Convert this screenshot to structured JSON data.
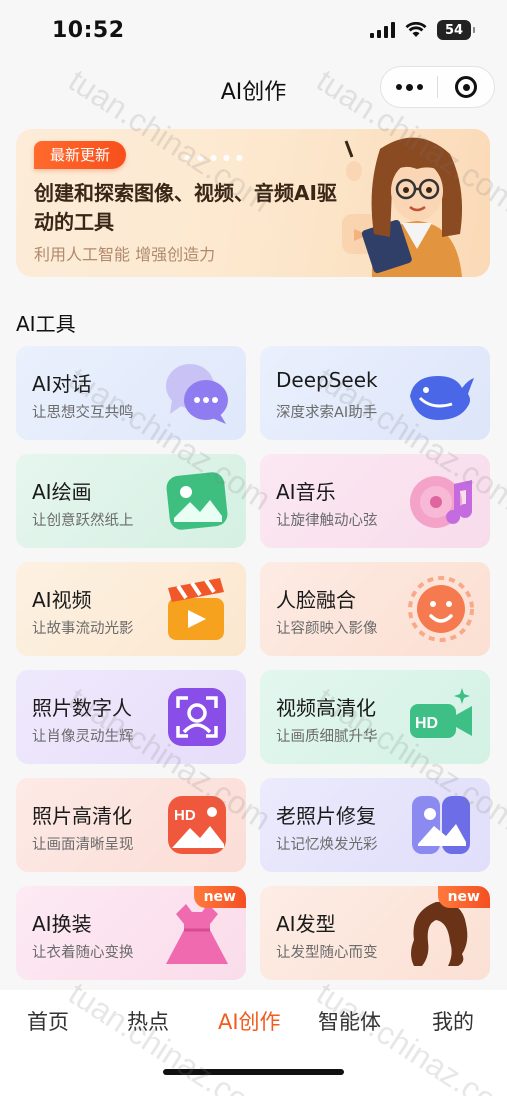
{
  "status_bar": {
    "time": "10:52",
    "battery": "54"
  },
  "nav": {
    "title": "AI创作"
  },
  "banner": {
    "badge": "最新更新",
    "title": "创建和探索图像、视频、音频AI驱动的工具",
    "subtitle": "利用人工智能 增强创造力"
  },
  "section": {
    "title": "AI工具"
  },
  "tools": [
    {
      "title": "AI对话",
      "subtitle": "让思想交互共鸣",
      "icon": "chat-bubbles-icon",
      "new": false
    },
    {
      "title": "DeepSeek",
      "subtitle": "深度求索AI助手",
      "icon": "whale-icon",
      "new": false
    },
    {
      "title": "AI绘画",
      "subtitle": "让创意跃然纸上",
      "icon": "picture-icon",
      "new": false
    },
    {
      "title": "AI音乐",
      "subtitle": "让旋律触动心弦",
      "icon": "music-disc-icon",
      "new": false
    },
    {
      "title": "AI视频",
      "subtitle": "让故事流动光影",
      "icon": "video-clapper-icon",
      "new": false
    },
    {
      "title": "人脸融合",
      "subtitle": "让容颜映入影像",
      "icon": "smiley-face-icon",
      "new": false
    },
    {
      "title": "照片数字人",
      "subtitle": "让肖像灵动生辉",
      "icon": "face-scan-icon",
      "new": false
    },
    {
      "title": "视频高清化",
      "subtitle": "让画质细腻升华",
      "icon": "hd-camera-icon",
      "new": false
    },
    {
      "title": "照片高清化",
      "subtitle": "让画面清晰呈现",
      "icon": "hd-photo-icon",
      "new": false
    },
    {
      "title": "老照片修复",
      "subtitle": "让记忆焕发光彩",
      "icon": "photo-restore-icon",
      "new": false
    },
    {
      "title": "AI换装",
      "subtitle": "让衣着随心变换",
      "icon": "dress-icon",
      "new": true,
      "badge": "new"
    },
    {
      "title": "AI发型",
      "subtitle": "让发型随心而变",
      "icon": "hair-icon",
      "new": true,
      "badge": "new"
    }
  ],
  "tabbar": {
    "tabs": [
      {
        "label": "首页",
        "active": false
      },
      {
        "label": "热点",
        "active": false
      },
      {
        "label": "AI创作",
        "active": true
      },
      {
        "label": "智能体",
        "active": false
      },
      {
        "label": "我的",
        "active": false
      }
    ]
  },
  "watermark": "tuan.chinaz.com",
  "colors": {
    "accent": "#f25a1e",
    "badge": "#f54f22"
  }
}
